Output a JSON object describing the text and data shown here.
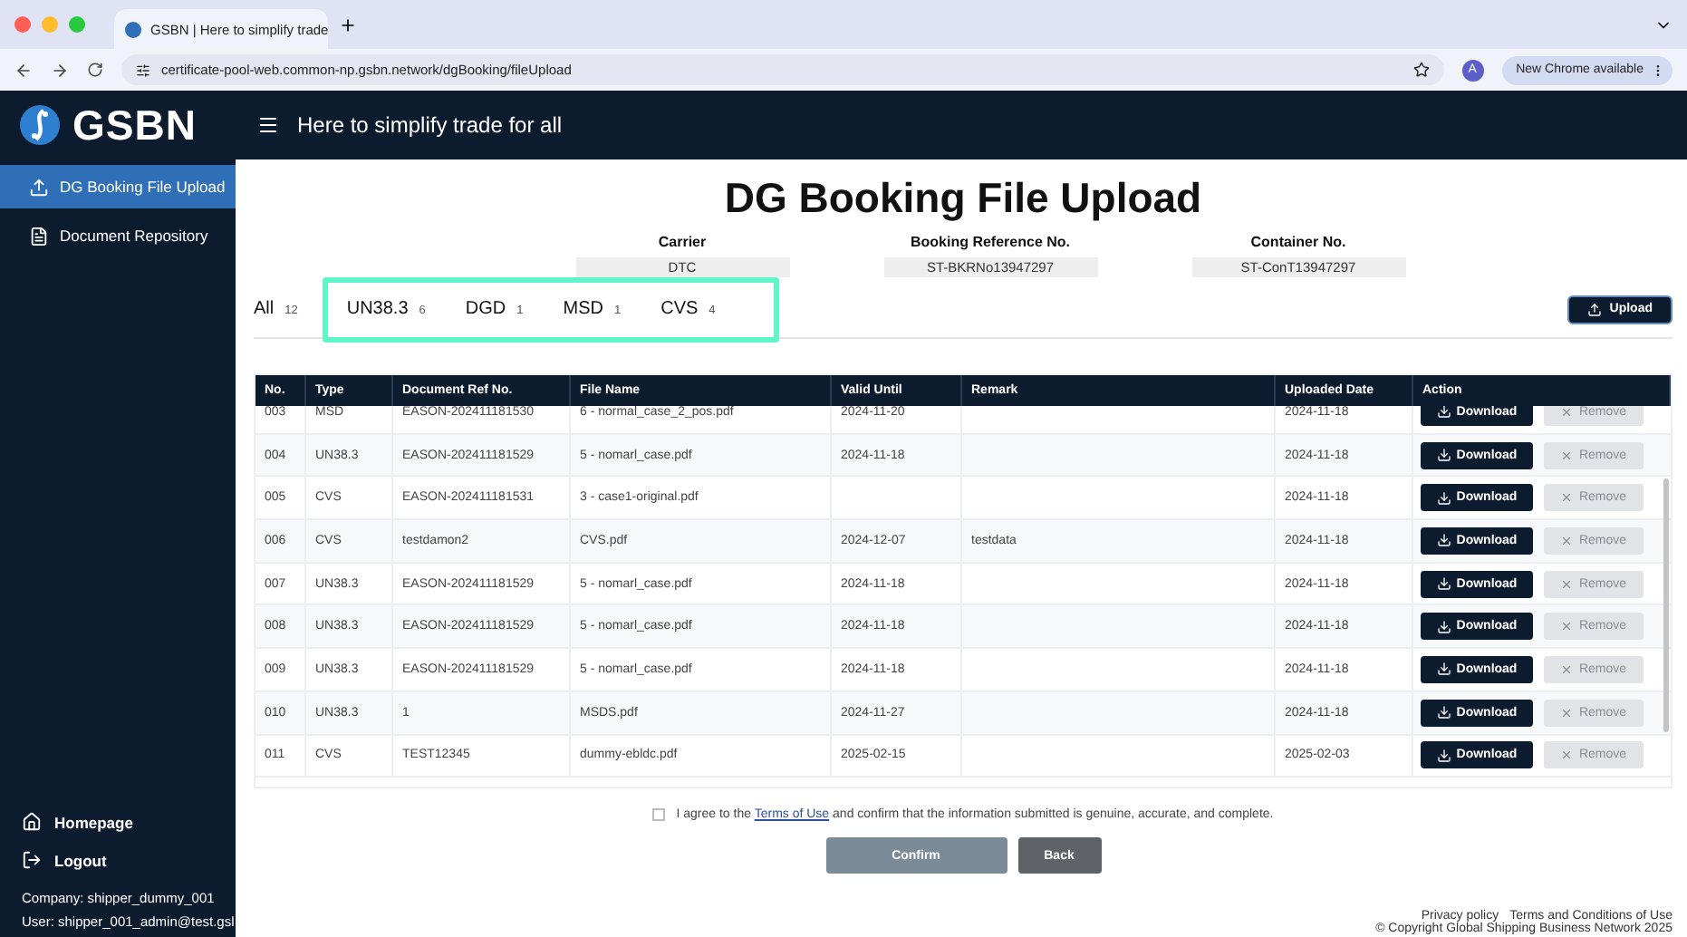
{
  "browser": {
    "tab_title": "GSBN | Here to simplify trade",
    "url": "certificate-pool-web.common-np.gsbn.network/dgBooking/fileUpload",
    "profile": "A",
    "update_button": "New Chrome available"
  },
  "header": {
    "logo": "GSBN",
    "tagline": "Here to simplify trade for all"
  },
  "sidebar": {
    "items": [
      {
        "label": "DG Booking File Upload",
        "selected": true
      },
      {
        "label": "Document Repository",
        "selected": false
      }
    ],
    "bottom_links": [
      {
        "label": "Homepage"
      },
      {
        "label": "Logout"
      }
    ],
    "company": "Company:  shipper_dummy_001",
    "user": "User:  shipper_001_admin@test.gsl"
  },
  "page_title": "DG Booking File Upload",
  "info_fields": [
    {
      "label": "Carrier",
      "value": "DTC"
    },
    {
      "label": "Booking Reference No.",
      "value": "ST-BKRNo13947297"
    },
    {
      "label": "Container No.",
      "value": "ST-ConT13947297"
    }
  ],
  "filter_tabs": [
    {
      "label": "All",
      "count": "12",
      "highlighted": false
    },
    {
      "label": "UN38.3",
      "count": "6",
      "highlighted": true
    },
    {
      "label": "DGD",
      "count": "1",
      "highlighted": true
    },
    {
      "label": "MSD",
      "count": "1",
      "highlighted": true
    },
    {
      "label": "CVS",
      "count": "4",
      "highlighted": true
    }
  ],
  "upload_button": "Upload",
  "table": {
    "columns": [
      "No.",
      "Type",
      "Document Ref No.",
      "File Name",
      "Valid Until",
      "Remark",
      "Uploaded Date",
      "Action"
    ],
    "rows": [
      {
        "no": "003",
        "type": "MSD",
        "ref": "EASON-202411181530",
        "file": "6 - normal_case_2_pos.pdf",
        "valid": "2024-11-20",
        "remark": "",
        "uploaded": "2024-11-18",
        "download": "Download",
        "remove": "Remove",
        "remove_disabled": true
      },
      {
        "no": "004",
        "type": "UN38.3",
        "ref": "EASON-202411181529",
        "file": "5 - nomarl_case.pdf",
        "valid": "2024-11-18",
        "remark": "",
        "uploaded": "2024-11-18",
        "download": "Download",
        "remove": "Remove",
        "remove_disabled": true
      },
      {
        "no": "005",
        "type": "CVS",
        "ref": "EASON-202411181531",
        "file": "3 - case1-original.pdf",
        "valid": "",
        "remark": "",
        "uploaded": "2024-11-18",
        "download": "Download",
        "remove": "Remove",
        "remove_disabled": true
      },
      {
        "no": "006",
        "type": "CVS",
        "ref": "testdamon2",
        "file": "CVS.pdf",
        "valid": "2024-12-07",
        "remark": "testdata",
        "uploaded": "2024-11-18",
        "download": "Download",
        "remove": "Remove",
        "remove_disabled": true
      },
      {
        "no": "007",
        "type": "UN38.3",
        "ref": "EASON-202411181529",
        "file": "5 - nomarl_case.pdf",
        "valid": "2024-11-18",
        "remark": "",
        "uploaded": "2024-11-18",
        "download": "Download",
        "remove": "Remove",
        "remove_disabled": true
      },
      {
        "no": "008",
        "type": "UN38.3",
        "ref": "EASON-202411181529",
        "file": "5 - nomarl_case.pdf",
        "valid": "2024-11-18",
        "remark": "",
        "uploaded": "2024-11-18",
        "download": "Download",
        "remove": "Remove",
        "remove_disabled": true
      },
      {
        "no": "009",
        "type": "UN38.3",
        "ref": "EASON-202411181529",
        "file": "5 - nomarl_case.pdf",
        "valid": "2024-11-18",
        "remark": "",
        "uploaded": "2024-11-18",
        "download": "Download",
        "remove": "Remove",
        "remove_disabled": true
      },
      {
        "no": "010",
        "type": "UN38.3",
        "ref": "1",
        "file": "MSDS.pdf",
        "valid": "2024-11-27",
        "remark": "",
        "uploaded": "2024-11-18",
        "download": "Download",
        "remove": "Remove",
        "remove_disabled": true
      },
      {
        "no": "011",
        "type": "CVS",
        "ref": "TEST12345",
        "file": "dummy-ebldc.pdf",
        "valid": "2025-02-15",
        "remark": "",
        "uploaded": "2025-02-03",
        "download": "Download",
        "remove": "Remove",
        "remove_disabled": true
      }
    ]
  },
  "agreement": {
    "checked": false,
    "before": "I agree to the",
    "link": "Terms of Use",
    "after": "and confirm that the information submitted is genuine, accurate, and complete."
  },
  "confirm_button": {
    "label": "Confirm",
    "disabled": true
  },
  "back_button": "Back",
  "footer": {
    "links": [
      "Privacy policy",
      "Terms and Conditions of Use"
    ],
    "copyright": "© Copyright Global Shipping Business Network 2025"
  }
}
